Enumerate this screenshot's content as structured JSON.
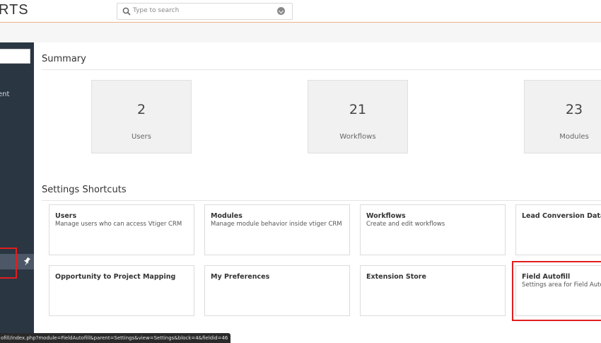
{
  "header": {
    "logo_text": "RTS",
    "search_placeholder": "Type to search"
  },
  "sidebar": {
    "visible_text": "ent",
    "active_item_icon": "pin-icon"
  },
  "summary": {
    "title": "Summary",
    "stats": [
      {
        "value": "2",
        "label": "Users"
      },
      {
        "value": "21",
        "label": "Workflows"
      },
      {
        "value": "23",
        "label": "Modules"
      }
    ]
  },
  "shortcuts": {
    "title": "Settings Shortcuts",
    "cards": [
      {
        "title": "Users",
        "desc": "Manage users who can access Vtiger CRM"
      },
      {
        "title": "Modules",
        "desc": "Manage module behavior inside vtiger CRM"
      },
      {
        "title": "Workflows",
        "desc": "Create and edit workflows"
      },
      {
        "title": "Lead Conversion Data Ma",
        "desc": ""
      },
      {
        "title": "Opportunity to Project Mapping",
        "desc": ""
      },
      {
        "title": "My Preferences",
        "desc": ""
      },
      {
        "title": "Extension Store",
        "desc": ""
      },
      {
        "title": "Field Autofill",
        "desc": "Settings area for Field Autof"
      }
    ]
  },
  "status_bar": {
    "url": "ofill/index.php?module=FieldAutofill&parent=Settings&view=Settings&block=4&fieldid=46"
  },
  "colors": {
    "sidebar_bg": "#2b3643",
    "highlight": "#e11e1e",
    "header_rule": "#f0b08a"
  }
}
